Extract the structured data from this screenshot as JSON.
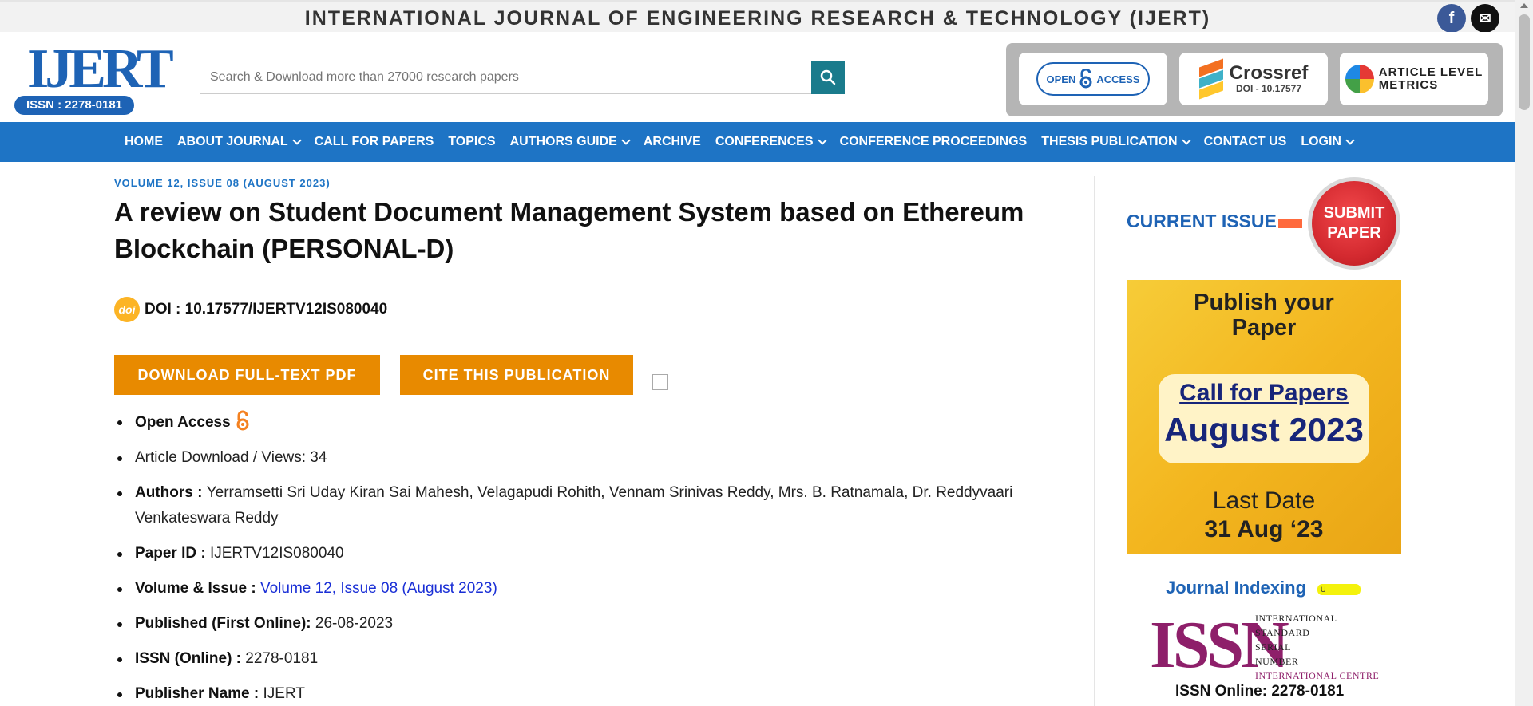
{
  "site": {
    "title": "INTERNATIONAL JOURNAL OF ENGINEERING RESEARCH & TECHNOLOGY (IJERT)",
    "logo_text": "IJERT",
    "logo_issn": "ISSN : 2278-0181",
    "social": [
      {
        "icon": "facebook-icon",
        "glyph": "f"
      },
      {
        "icon": "mail-icon",
        "glyph": "✉"
      }
    ]
  },
  "search": {
    "placeholder": "Search & Download more than 27000 research papers"
  },
  "badges": {
    "open_access": {
      "line1": "OPEN",
      "line2": "ACCESS"
    },
    "crossref": {
      "name": "Crossref",
      "doi": "DOI - 10.17577"
    },
    "alm": {
      "line1": "ARTICLE LEVEL",
      "line2": "METRICS"
    }
  },
  "nav": [
    {
      "label": "HOME",
      "dropdown": false
    },
    {
      "label": "ABOUT JOURNAL",
      "dropdown": true
    },
    {
      "label": "CALL FOR PAPERS",
      "dropdown": false
    },
    {
      "label": "TOPICS",
      "dropdown": false
    },
    {
      "label": "AUTHORS GUIDE",
      "dropdown": true
    },
    {
      "label": "ARCHIVE",
      "dropdown": false
    },
    {
      "label": "CONFERENCES",
      "dropdown": true
    },
    {
      "label": "CONFERENCE PROCEEDINGS",
      "dropdown": false
    },
    {
      "label": "THESIS PUBLICATION",
      "dropdown": true
    },
    {
      "label": "CONTACT US",
      "dropdown": false
    },
    {
      "label": "LOGIN",
      "dropdown": true
    }
  ],
  "article": {
    "volume_tag": "VOLUME 12, ISSUE 08 (AUGUST 2023)",
    "title": "A review on Student Document Management System based on Ethereum Blockchain (PERSONAL-D)",
    "doi_icon": "doi",
    "doi": "DOI : 10.17577/IJERTV12IS080040",
    "download_btn": "DOWNLOAD FULL-TEXT PDF",
    "cite_btn": "CITE THIS PUBLICATION",
    "meta": {
      "open_access": "Open Access",
      "views": " Article Download / Views: 34",
      "authors_label": "Authors : ",
      "authors": "Yerramsetti Sri Uday Kiran Sai Mahesh, Velagapudi Rohith, Vennam Srinivas Reddy, Mrs. B. Ratnamala, Dr. Reddyvaari Venkateswara Reddy",
      "paper_id_label": "Paper ID : ",
      "paper_id": "IJERTV12IS080040",
      "volume_label": "Volume & Issue : ",
      "volume": "Volume 12, Issue 08 (August 2023)",
      "published_label": "Published (First Online): ",
      "published": "26-08-2023",
      "issn_label": "ISSN (Online) : ",
      "issn": "2278-0181",
      "publisher_label": "Publisher Name : ",
      "publisher": "IJERT"
    }
  },
  "sidebar": {
    "current_issue": "CURRENT ISSUE",
    "submit_line1": "SUBMIT",
    "submit_line2": "PAPER",
    "promo": {
      "line1": "Publish your",
      "line2": "Paper",
      "cfp": "Call for Papers",
      "month": "August 2023",
      "last": "Last Date",
      "date": "31 Aug ‘23"
    },
    "indexing": "Journal Indexing",
    "indexing_mark": "U",
    "issn_logo": {
      "mark": "ISSN",
      "w1": "INTERNATIONAL",
      "w2": "STANDARD",
      "w3": "SERIAL",
      "w4": "NUMBER",
      "w5": "INTERNATIONAL CENTRE"
    },
    "issn_online": "ISSN Online: 2278-0181"
  },
  "colors": {
    "nav_bg": "#1e74c5",
    "button_orange": "#e88a00",
    "link_blue": "#1a2fd6",
    "brand_blue": "#1e63b5"
  }
}
